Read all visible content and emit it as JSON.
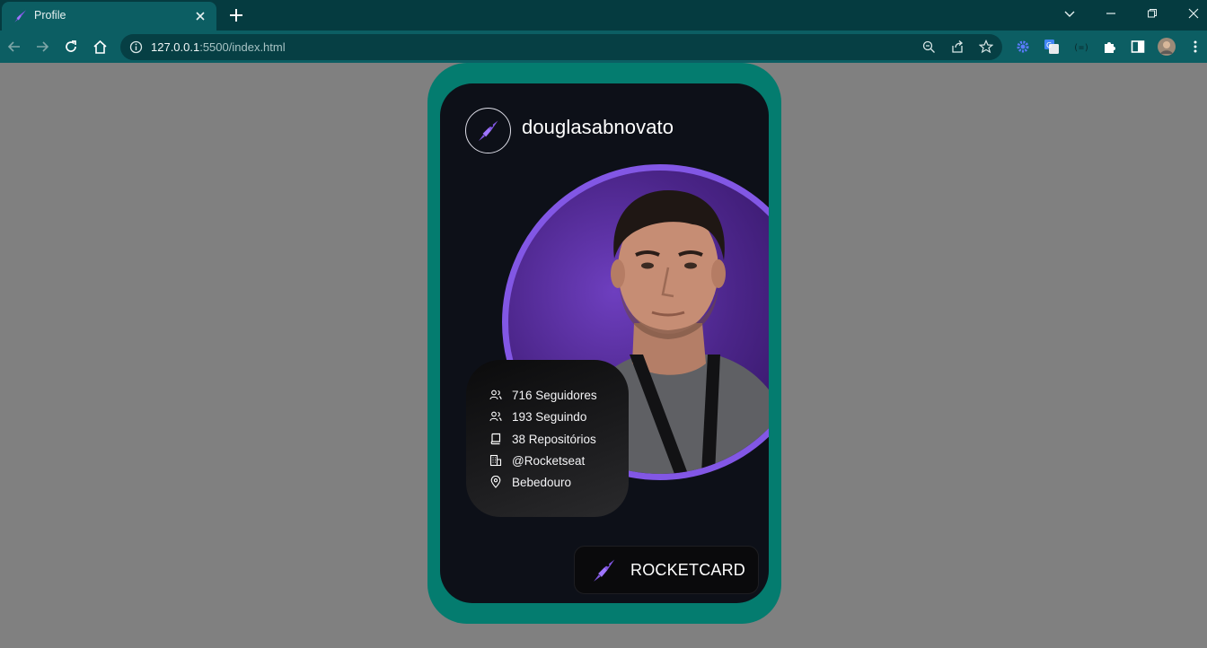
{
  "browser": {
    "tab_title": "Profile",
    "url_host": "127.0.0.1",
    "url_rest": ":5500/index.html"
  },
  "profile": {
    "username": "douglasabnovato",
    "stats": [
      {
        "icon": "users-icon",
        "text": "716 Seguidores"
      },
      {
        "icon": "users-icon",
        "text": "193 Seguindo"
      },
      {
        "icon": "book-icon",
        "text": "38 Repositórios"
      },
      {
        "icon": "building-icon",
        "text": "@Rocketseat"
      },
      {
        "icon": "map-pin-icon",
        "text": "Bebedouro"
      }
    ],
    "brand_label": "ROCKETCARD"
  },
  "colors": {
    "card_border": "#047c6f",
    "card_bg": "#0d1018",
    "accent_purple": "#8257e5",
    "page_bg": "#808080"
  }
}
